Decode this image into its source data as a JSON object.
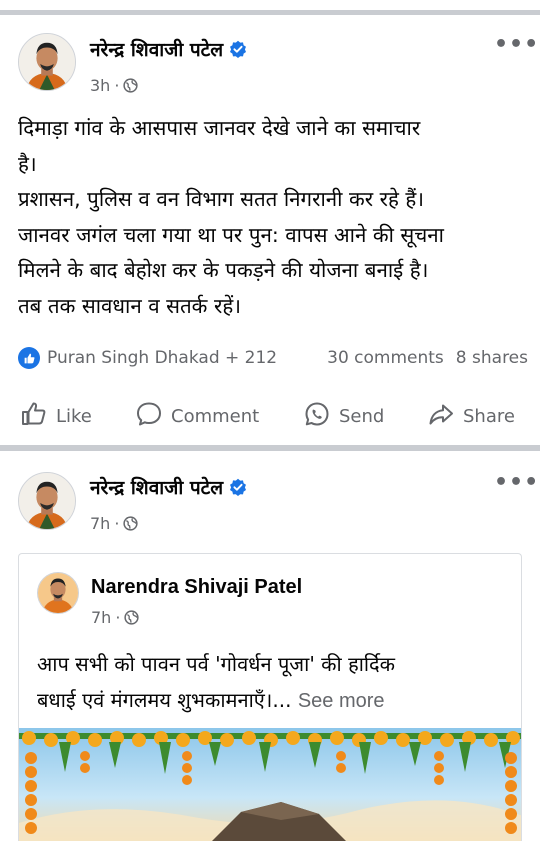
{
  "post1": {
    "author": "नरेन्द्र शिवाजी पटेल",
    "time": "3h",
    "more_label": "•••",
    "lines": [
      "दिमाड़ा गांव के आसपास जानवर देखे जाने का समाचार",
      "है।",
      "प्रशासन, पुलिस व वन विभाग सतत निगरानी कर रहे हैं।",
      "जानवर जगंल चला गया था पर पुन: वापस आने की सूचना",
      "मिलने के बाद बेहोश कर के पकड़ने की योजना बनाई है।",
      "तब तक सावधान व सतर्क रहें।"
    ],
    "reactions": "Puran Singh Dhakad + 212",
    "comments": "30 comments",
    "shares": "8 shares"
  },
  "actions": {
    "like": "Like",
    "comment": "Comment",
    "send": "Send",
    "share": "Share"
  },
  "post2": {
    "author": "नरेन्द्र शिवाजी पटेल",
    "time": "7h",
    "more_label": "•••",
    "shared": {
      "author": "Narendra Shivaji Patel",
      "time": "7h",
      "line1": "आप सभी को पावन पर्व 'गोवर्धन पूजा' की हार्दिक",
      "line2": "बधाई एवं मंगलमय शुभकामनाएँ।...",
      "see_more": "See more"
    }
  },
  "colors": {
    "accent": "#1b74e4",
    "secondary_text": "#65676b",
    "separator": "#c9ccd1",
    "marigold": "#f4a81d",
    "leaf": "#3d8b2f"
  },
  "icons": [
    "verified-badge-icon",
    "globe-icon",
    "more-options-icon",
    "like-thumb-icon",
    "comment-bubble-icon",
    "whatsapp-send-icon",
    "share-arrow-icon"
  ]
}
